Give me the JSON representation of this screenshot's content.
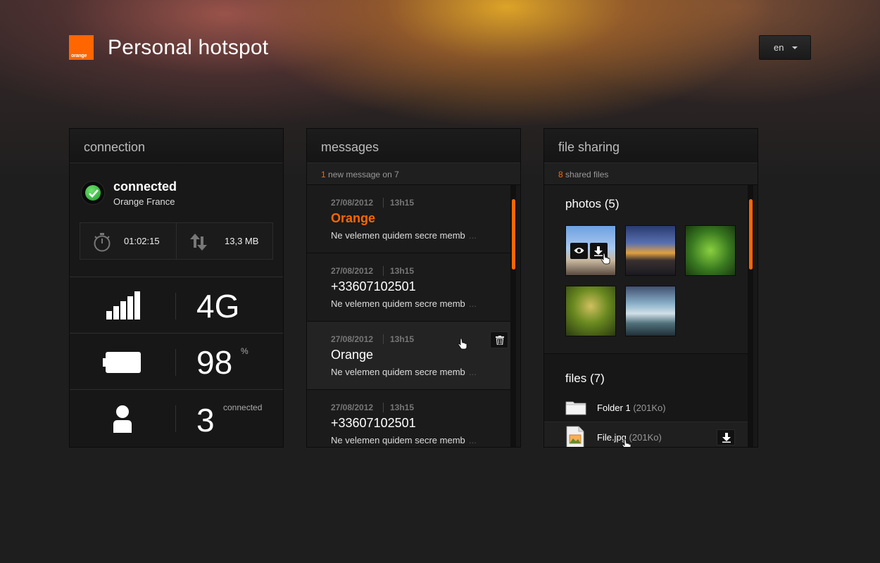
{
  "header": {
    "logo_text": "orange",
    "title": "Personal hotspot",
    "language": "en"
  },
  "connection": {
    "title": "connection",
    "status": "connected",
    "operator": "Orange France",
    "duration": "01:02:15",
    "data_used": "13,3 MB",
    "network": "4G",
    "battery": "98",
    "battery_unit": "%",
    "clients": "3",
    "clients_label": "connected",
    "signal_bars": 5,
    "icons": [
      "check-icon",
      "stopwatch-icon",
      "transfer-arrows-icon",
      "signal-bars-icon",
      "battery-icon",
      "user-icon"
    ]
  },
  "messages": {
    "title": "messages",
    "new_count": "1",
    "new_text": "new message on 7",
    "items": [
      {
        "date": "27/08/2012",
        "time": "13h15",
        "from": "Orange",
        "body": "Ne velemen quidem secre memb",
        "ellipsis": "...",
        "unread": true
      },
      {
        "date": "27/08/2012",
        "time": "13h15",
        "from": "+33607102501",
        "body": "Ne velemen quidem secre memb",
        "ellipsis": "...",
        "unread": false
      },
      {
        "date": "27/08/2012",
        "time": "13h15",
        "from": "Orange",
        "body": "Ne velemen quidem secre memb",
        "ellipsis": "...",
        "unread": false
      },
      {
        "date": "27/08/2012",
        "time": "13h15",
        "from": "+33607102501",
        "body": "Ne velemen quidem secre memb",
        "ellipsis": "...",
        "unread": false
      }
    ]
  },
  "file_sharing": {
    "title": "file sharing",
    "shared_count": "8",
    "shared_text": "shared files",
    "photos_title": "photos (5)",
    "files_title": "files (7)",
    "files": [
      {
        "name": "Folder 1",
        "size": "(201Ko)"
      },
      {
        "name": "File.jpg",
        "size": "(201Ko)"
      }
    ]
  },
  "colors": {
    "accent": "#ff6600",
    "status_ok": "#2fb43a",
    "panel_bg": "#181818"
  }
}
